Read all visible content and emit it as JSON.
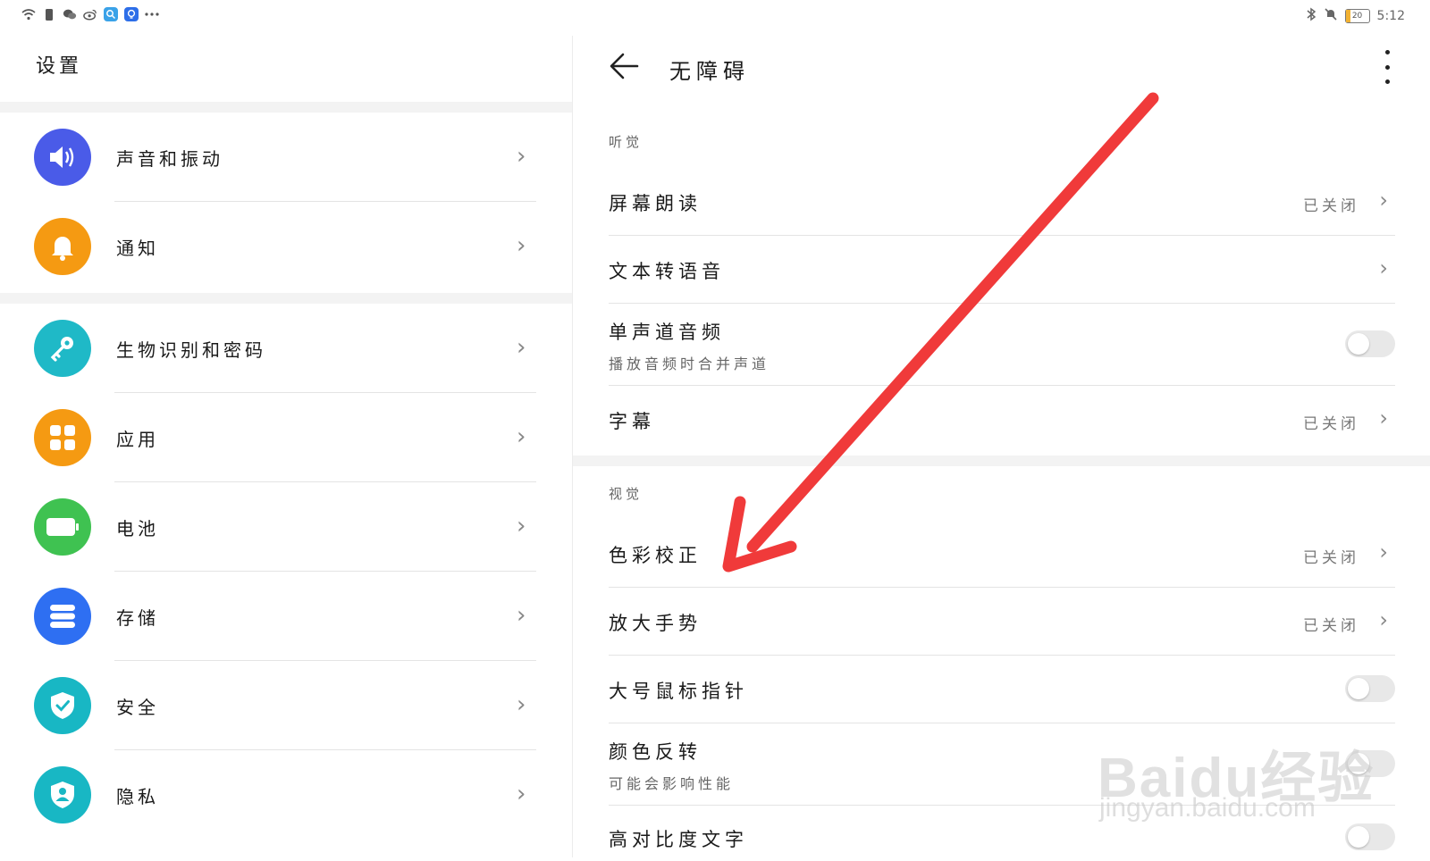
{
  "status_bar": {
    "left_icons": [
      "wifi-icon",
      "sim-icon",
      "wechat-icon",
      "weibo-icon",
      "app-search-icon",
      "app-bulb-icon",
      "more-dots-icon"
    ],
    "battery_level": "20",
    "time": "5:12"
  },
  "left_pane": {
    "title": "设置",
    "items": [
      {
        "label": "声音和振动",
        "icon": "speaker-icon",
        "color": "#4a5be8"
      },
      {
        "label": "通知",
        "icon": "bell-icon",
        "color": "#f59a12"
      },
      {
        "label": "生物识别和密码",
        "icon": "key-icon",
        "color": "#1fb9c7"
      },
      {
        "label": "应用",
        "icon": "apps-grid-icon",
        "color": "#f59a12"
      },
      {
        "label": "电池",
        "icon": "battery-icon",
        "color": "#3fc251"
      },
      {
        "label": "存储",
        "icon": "storage-icon",
        "color": "#2e6ff2"
      },
      {
        "label": "安全",
        "icon": "shield-icon",
        "color": "#18b7c4"
      },
      {
        "label": "隐私",
        "icon": "privacy-icon",
        "color": "#18b7c4"
      }
    ]
  },
  "right_pane": {
    "title": "无障碍",
    "section_hearing": "听觉",
    "section_vision": "视觉",
    "rows": {
      "screen_reader": {
        "title": "屏幕朗读",
        "status": "已关闭"
      },
      "tts": {
        "title": "文本转语音"
      },
      "mono_audio": {
        "title": "单声道音频",
        "subtitle": "播放音频时合并声道",
        "toggle": "off"
      },
      "captions": {
        "title": "字幕",
        "status": "已关闭"
      },
      "color_correction": {
        "title": "色彩校正",
        "status": "已关闭"
      },
      "magnify_gesture": {
        "title": "放大手势",
        "status": "已关闭"
      },
      "large_pointer": {
        "title": "大号鼠标指针",
        "toggle": "off"
      },
      "color_inversion": {
        "title": "颜色反转",
        "subtitle": "可能会影响性能",
        "toggle": "off"
      },
      "high_contrast": {
        "title": "高对比度文字",
        "toggle": "off"
      }
    }
  },
  "watermark": {
    "line1": "Baidu经验",
    "line2": "jingyan.baidu.com"
  },
  "annotation_color": "#f03a3a"
}
